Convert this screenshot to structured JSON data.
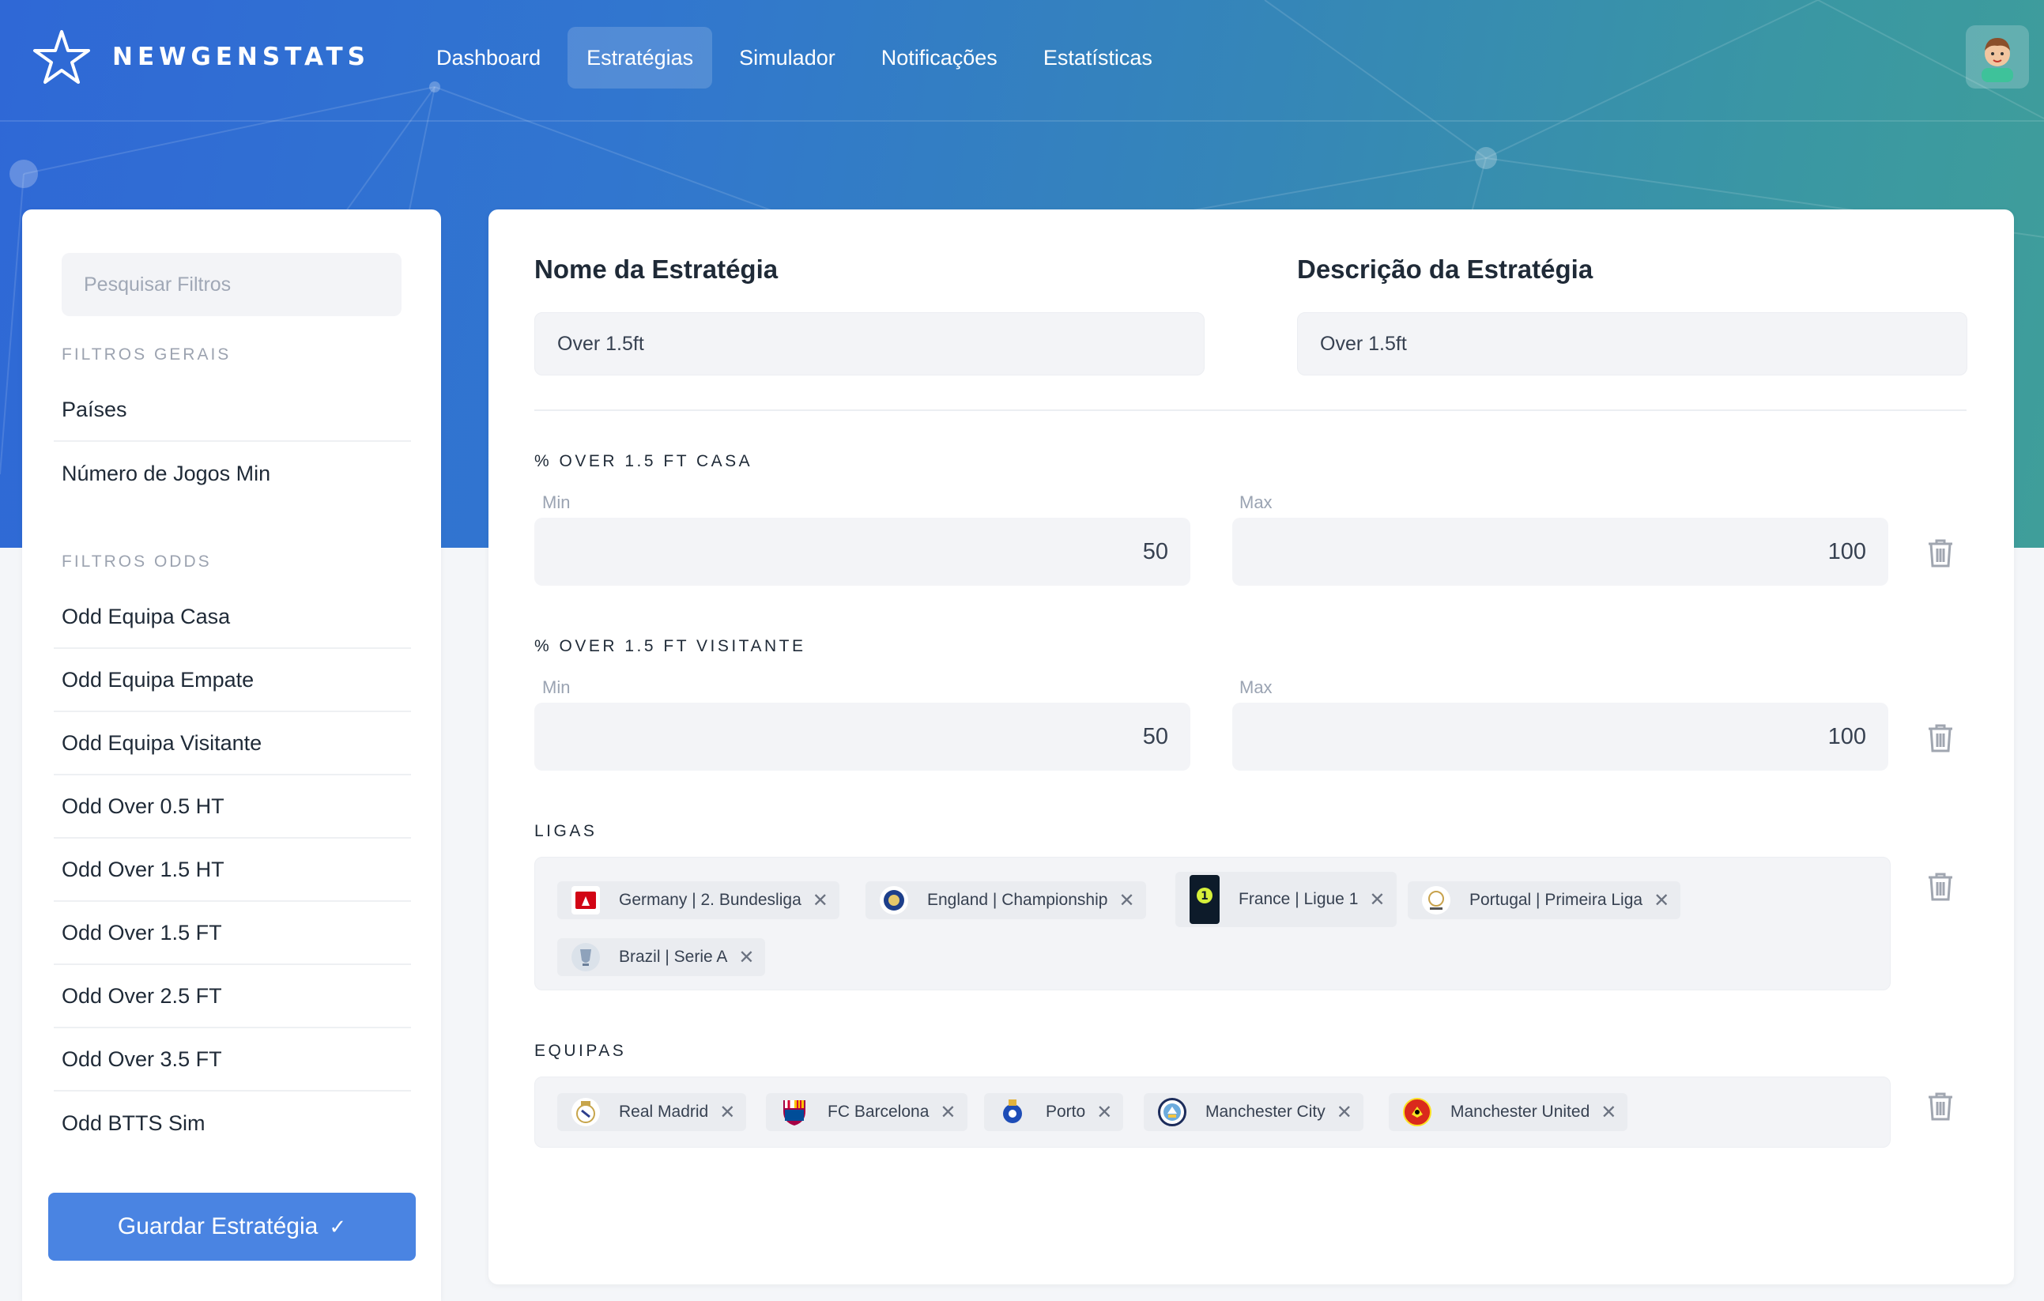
{
  "app": {
    "brand": "NEWGENSTATS"
  },
  "nav": {
    "items": [
      {
        "label": "Dashboard",
        "active": false
      },
      {
        "label": "Estratégias",
        "active": true
      },
      {
        "label": "Simulador",
        "active": false
      },
      {
        "label": "Notificações",
        "active": false
      },
      {
        "label": "Estatísticas",
        "active": false
      }
    ]
  },
  "sidebar": {
    "search_placeholder": "Pesquisar Filtros",
    "general_title": "FILTROS GERAIS",
    "general_items": [
      "Países",
      "Número de Jogos Min"
    ],
    "odds_title": "FILTROS ODDS",
    "odds_items": [
      "Odd Equipa Casa",
      "Odd Equipa Empate",
      "Odd Equipa Visitante",
      "Odd Over 0.5 HT",
      "Odd Over 1.5 HT",
      "Odd Over 1.5 FT",
      "Odd Over 2.5 FT",
      "Odd Over 3.5 FT",
      "Odd BTTS Sim"
    ],
    "save_label": "Guardar Estratégia"
  },
  "strategy": {
    "name_title": "Nome da Estratégia",
    "name_value": "Over 1.5ft",
    "desc_title": "Descrição da Estratégia",
    "desc_value": "Over 1.5ft"
  },
  "filters": {
    "over_home": {
      "title": "% OVER 1.5 FT CASA",
      "min_label": "Min",
      "min_value": "50",
      "max_label": "Max",
      "max_value": "100"
    },
    "over_away": {
      "title": "% OVER 1.5 FT VISITANTE",
      "min_label": "Min",
      "min_value": "50",
      "max_label": "Max",
      "max_value": "100"
    }
  },
  "leagues": {
    "title": "LIGAS",
    "items": [
      "Germany | 2. Bundesliga",
      "England | Championship",
      "France | Ligue 1",
      "Portugal | Primeira Liga",
      "Brazil | Serie A"
    ]
  },
  "teams": {
    "title": "EQUIPAS",
    "items": [
      "Real Madrid",
      "FC Barcelona",
      "Porto",
      "Manchester City",
      "Manchester United"
    ]
  },
  "colors": {
    "accent": "#4a84e2",
    "hero_start": "#2f68d6",
    "hero_end": "#3f9e9a"
  }
}
